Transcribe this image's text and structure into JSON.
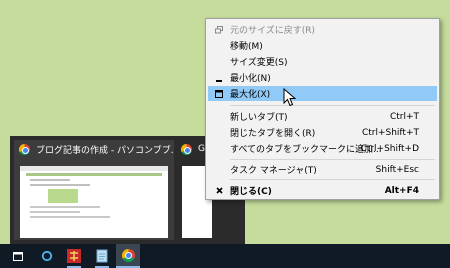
{
  "context_menu": {
    "items": [
      {
        "label": "元のサイズに戻す(R)",
        "icon": "restore-icon",
        "disabled": true
      },
      {
        "label": "移動(M)"
      },
      {
        "label": "サイズ変更(S)"
      },
      {
        "label": "最小化(N)",
        "icon": "minimize-icon"
      },
      {
        "label": "最大化(X)",
        "icon": "maximize-icon",
        "highlighted": true
      },
      {
        "label": "新しいタブ(T)",
        "shortcut": "Ctrl+T"
      },
      {
        "label": "閉じたタブを開く(R)",
        "shortcut": "Ctrl+Shift+T"
      },
      {
        "label": "すべてのタブをブックマークに追加...",
        "shortcut": "Ctrl+Shift+D"
      },
      {
        "label": "タスク マネージャ(T)",
        "shortcut": "Shift+Esc"
      },
      {
        "label": "閉じる(C)",
        "shortcut": "Alt+F4",
        "icon": "close-icon"
      }
    ]
  },
  "previews": [
    {
      "title": "ブログ記事の作成 - パソコンブブ...",
      "icon": "chrome-icon"
    },
    {
      "title": "Go...",
      "icon": "chrome-icon"
    }
  ],
  "taskbar": {
    "icons": [
      "task-view-icon",
      "cortana-icon",
      "app-icon",
      "notepad-icon",
      "chrome-icon"
    ]
  }
}
